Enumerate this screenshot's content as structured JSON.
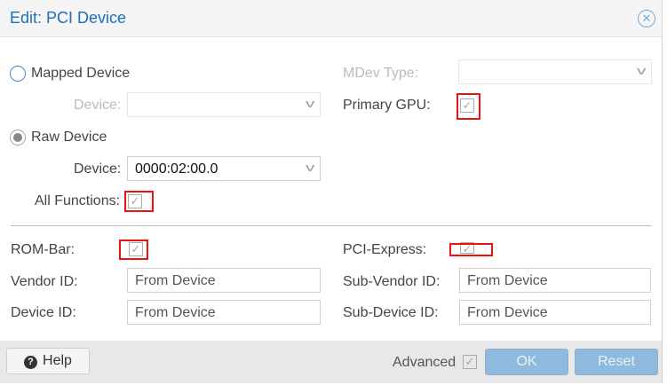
{
  "title": "Edit: PCI Device",
  "mapped_device": {
    "label": "Mapped Device",
    "device_label": "Device:",
    "device_value": ""
  },
  "raw_device": {
    "label": "Raw Device",
    "device_label": "Device:",
    "device_value": "0000:02:00.0",
    "all_functions_label": "All Functions:",
    "all_functions_checked": true
  },
  "mdev_type": {
    "label": "MDev Type:",
    "value": ""
  },
  "primary_gpu": {
    "label": "Primary GPU:",
    "checked": true
  },
  "rom_bar": {
    "label": "ROM-Bar:",
    "checked": true
  },
  "pci_express": {
    "label": "PCI-Express:",
    "checked": true
  },
  "vendor_id": {
    "label": "Vendor ID:",
    "placeholder": "From Device"
  },
  "device_id": {
    "label": "Device ID:",
    "placeholder": "From Device"
  },
  "sub_vendor_id": {
    "label": "Sub-Vendor ID:",
    "placeholder": "From Device"
  },
  "sub_device_id": {
    "label": "Sub-Device ID:",
    "placeholder": "From Device"
  },
  "footer": {
    "help": "Help",
    "advanced": "Advanced",
    "advanced_checked": true,
    "ok": "OK",
    "reset": "Reset"
  },
  "colors": {
    "title": "#1c6fb9",
    "primary_button": "#8fbadd",
    "highlight": "#e11111"
  }
}
